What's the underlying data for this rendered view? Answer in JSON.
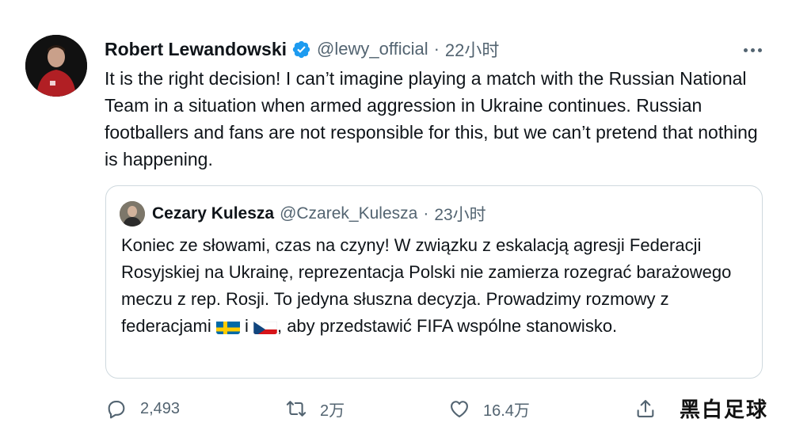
{
  "tweet": {
    "author_name": "Robert Lewandowski",
    "handle": "@lewy_official",
    "separator": "·",
    "time": "22小时",
    "text": "It is the right decision!  I can’t imagine playing a match with the Russian National Team in a situation when armed aggression in Ukraine continues. Russian footballers and fans are not responsible for this, but we can’t pretend that nothing is happening."
  },
  "quote": {
    "author_name": "Cezary Kulesza",
    "handle": "@Czarek_Kulesza",
    "separator": "·",
    "time": "23小时",
    "text_part1": "Koniec ze słowami, czas na czyny! W związku z eskalacją agresji Federacji Rosyjskiej na Ukrainę, reprezentacja Polski nie zamierza rozegrać barażowego meczu z rep. Rosji. To jedyna słuszna decyzja. Prowadzimy rozmowy z federacjami ",
    "text_mid": " i ",
    "text_part2": ", aby przedstawić FIFA wspólne stanowisko.",
    "flags": [
      "sweden-flag",
      "czech-flag"
    ]
  },
  "actions": {
    "replies": "2,493",
    "retweets": "2万",
    "likes": "16.4万"
  },
  "watermark": "黑白足球",
  "colors": {
    "text": "#0f1419",
    "secondary": "#536471",
    "verified": "#1d9bf0",
    "border": "#cfd9de"
  }
}
